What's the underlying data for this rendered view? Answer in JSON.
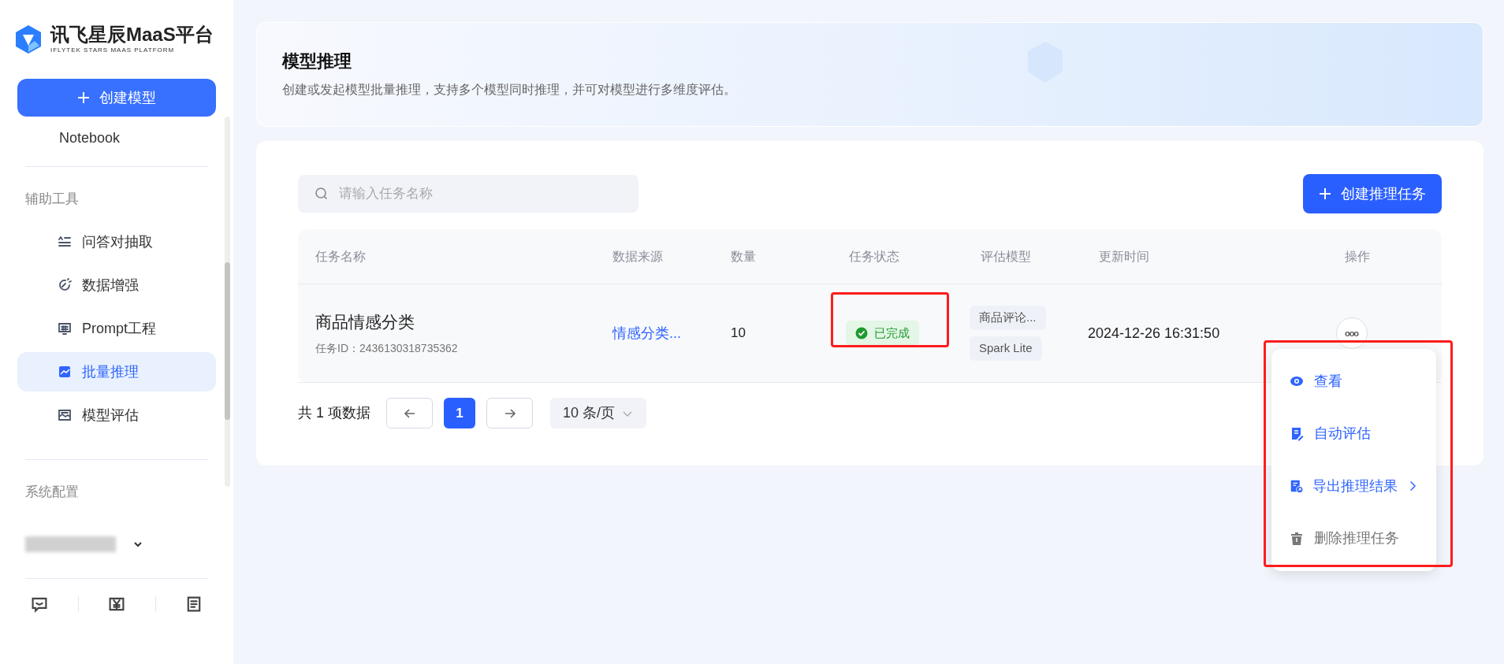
{
  "brand": {
    "name": "讯飞星辰MaaS平台",
    "tagline": "IFLYTEK STARS MAAS PLATFORM"
  },
  "sidebar": {
    "create_button": "创建模型",
    "clipped_item": "Notebook",
    "sections": [
      {
        "title": "辅助工具",
        "items": [
          {
            "label": "问答对抽取",
            "kind": "qa",
            "selected": false
          },
          {
            "label": "数据增强",
            "kind": "boost",
            "selected": false
          },
          {
            "label": "Prompt工程",
            "kind": "prompt",
            "selected": false
          },
          {
            "label": "批量推理",
            "kind": "batch",
            "selected": true
          },
          {
            "label": "模型评估",
            "kind": "eval",
            "selected": false
          }
        ]
      },
      {
        "title": "系统配置"
      }
    ]
  },
  "header": {
    "title": "模型推理",
    "description": "创建或发起模型批量推理，支持多个模型同时推理，并可对模型进行多维度评估。"
  },
  "toolbar": {
    "search_placeholder": "请输入任务名称",
    "create_button": "创建推理任务"
  },
  "table": {
    "columns": [
      "任务名称",
      "数据来源",
      "数量",
      "任务状态",
      "评估模型",
      "更新时间",
      "操作"
    ],
    "rows": [
      {
        "name": "商品情感分类",
        "task_id": "任务ID：2436130318735362",
        "source": "情感分类...",
        "count": "10",
        "status": "已完成",
        "status_highlighted": true,
        "models": [
          "商品评论...",
          "Spark Lite"
        ],
        "updated": "2024-12-26 16:31:50",
        "actions_label": "ooo"
      }
    ]
  },
  "pagination": {
    "total": "共 1 项数据",
    "pages": [
      {
        "label": "1",
        "selected": true
      }
    ],
    "page_size": "10 条/页"
  },
  "action_menu": {
    "highlighted": true,
    "items": [
      {
        "label": "查看",
        "kind": "eye",
        "disabled": false,
        "submenu": false
      },
      {
        "label": "自动评估",
        "kind": "doc-edit",
        "disabled": false,
        "submenu": false
      },
      {
        "label": "导出推理结果",
        "kind": "export",
        "disabled": false,
        "submenu": true
      },
      {
        "label": "删除推理任务",
        "kind": "trash",
        "disabled": true,
        "submenu": false
      }
    ]
  }
}
